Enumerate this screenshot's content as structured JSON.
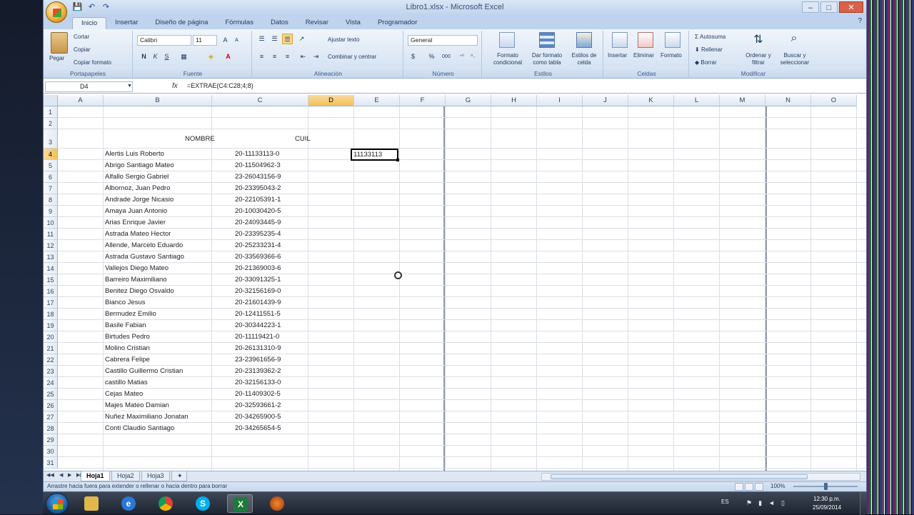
{
  "window": {
    "title": "Libro1.xlsx - Microsoft Excel",
    "controls": [
      "–",
      "□",
      "✕"
    ]
  },
  "quick_access": [
    "💾",
    "↶",
    "↷"
  ],
  "tabs": [
    "Inicio",
    "Insertar",
    "Diseño de página",
    "Fórmulas",
    "Datos",
    "Revisar",
    "Vista",
    "Programador"
  ],
  "active_tab": "Inicio",
  "ribbon": {
    "clipboard": {
      "label": "Portapapeles",
      "paste": "Pegar",
      "cut": "Cortar",
      "copy": "Copiar",
      "format_painter": "Copiar formato"
    },
    "font": {
      "label": "Fuente",
      "name": "Calibri",
      "size": "11",
      "bold": "N",
      "italic": "K",
      "underline": "S"
    },
    "alignment": {
      "label": "Alineación",
      "wrap": "Ajustar texto",
      "merge": "Combinar y centrar"
    },
    "number": {
      "label": "Número",
      "format": "General",
      "currency": "$",
      "percent": "%",
      "thousands": "000"
    },
    "styles": {
      "label": "Estilos",
      "conditional": "Formato condicional",
      "as_table": "Dar formato como tabla",
      "cell_styles": "Estilos de celda"
    },
    "cells": {
      "label": "Celdas",
      "insert": "Insertar",
      "delete": "Eliminar",
      "format": "Formato"
    },
    "editing": {
      "label": "Modificar",
      "autosum": "Autosuma",
      "fill": "Rellenar",
      "clear": "Borrar",
      "sort": "Ordenar y filtrar",
      "find": "Buscar y seleccionar"
    }
  },
  "formula_bar": {
    "name_box": "D4",
    "fx": "fx",
    "formula": "=EXTRAE(C4:C28;4;8)"
  },
  "columns": [
    "A",
    "B",
    "C",
    "D",
    "E",
    "F",
    "G",
    "H",
    "I",
    "J",
    "K",
    "L",
    "M",
    "N",
    "O"
  ],
  "selected_column": "D",
  "selected_row": 4,
  "rows": [
    "1",
    "2",
    "3",
    "4",
    "5",
    "6",
    "7",
    "8",
    "9",
    "10",
    "11",
    "12",
    "13",
    "14",
    "15",
    "16",
    "17",
    "18",
    "19",
    "20",
    "21",
    "22",
    "23",
    "24",
    "25",
    "26",
    "27",
    "28",
    "29",
    "30",
    "31"
  ],
  "headers": {
    "nombre": "NOMBRE",
    "cuil": "CUIL"
  },
  "data": [
    {
      "nombre": "Alertis Luis Roberto",
      "cuil": "20-11133113-0"
    },
    {
      "nombre": "Abrigo Santiago Mateo",
      "cuil": "20-11504962-3"
    },
    {
      "nombre": "Alfallo Sergio Gabriel",
      "cuil": "23-26043156-9"
    },
    {
      "nombre": "Albornoz, Juan Pedro",
      "cuil": "20-23395043-2"
    },
    {
      "nombre": "Andrade Jorge Nicasio",
      "cuil": "20-22105391-1"
    },
    {
      "nombre": "Amaya Juan Antonio",
      "cuil": "20-10030420-5"
    },
    {
      "nombre": "Arias Enrique Javier",
      "cuil": "20-24093445-9"
    },
    {
      "nombre": "Astrada Mateo Hector",
      "cuil": "20-23395235-4"
    },
    {
      "nombre": "Allende, Marcelo Eduardo",
      "cuil": "20-25233231-4"
    },
    {
      "nombre": "Astrada Gustavo Santiago",
      "cuil": "20-33569366-6"
    },
    {
      "nombre": "Vallejos Diego Mateo",
      "cuil": "20-21369003-6"
    },
    {
      "nombre": "Barreiro Maximiliano",
      "cuil": "20-33091325-1"
    },
    {
      "nombre": "Benitez Diego Osvaldo",
      "cuil": "20-32156169-0"
    },
    {
      "nombre": "Bianco Jesus",
      "cuil": "20-21601439-9"
    },
    {
      "nombre": "Bermudez Emilio",
      "cuil": "20-12411551-5"
    },
    {
      "nombre": "Basile Fabian",
      "cuil": "20-30344223-1"
    },
    {
      "nombre": "Birtudes Pedro",
      "cuil": "20-11119421-0"
    },
    {
      "nombre": "Molino Cristian",
      "cuil": "20-26131310-9"
    },
    {
      "nombre": "Cabrera Felipe",
      "cuil": "23-23961656-9"
    },
    {
      "nombre": "Castillo Guillermo Cristian",
      "cuil": "20-23139362-2"
    },
    {
      "nombre": "castillo Matias",
      "cuil": "20-32156133-0"
    },
    {
      "nombre": "Cejas Mateo",
      "cuil": "20-11409302-5"
    },
    {
      "nombre": "Majes Mateo Damian",
      "cuil": "20-32593661-2"
    },
    {
      "nombre": "Nuñez Maximiliano Jonatan",
      "cuil": "20-34265900-5"
    },
    {
      "nombre": "Conti Claudio Santiago",
      "cuil": "20-34265654-5"
    }
  ],
  "d4_value": "11133113",
  "sheets": [
    "Hoja1",
    "Hoja2",
    "Hoja3"
  ],
  "active_sheet": "Hoja1",
  "status": {
    "message": "Arrastre hacia fuera para extender o rellenar o hacia dentro para borrar",
    "zoom": "100%"
  },
  "taskbar": {
    "lang": "ES",
    "time": "12:30 p.m.",
    "date": "25/09/2014"
  }
}
